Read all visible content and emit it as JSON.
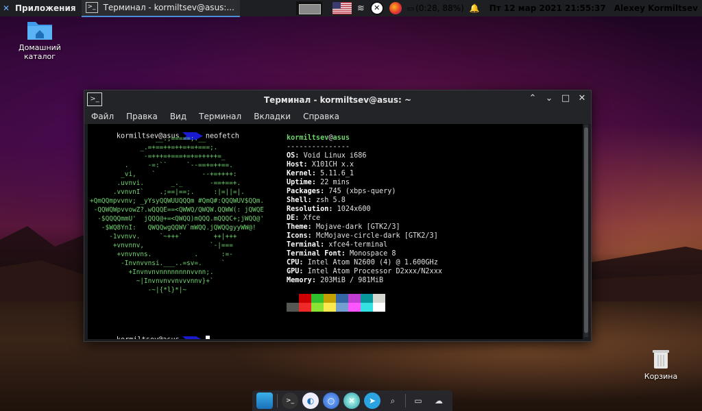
{
  "panel": {
    "apps_label": "Приложения",
    "task_label": "Терминал - kormiltsev@asus:...",
    "battery": "(0:28, 88%)",
    "datetime": "Пт 12 мар 2021 21:55:37",
    "user": "Alexey Kormiltsev"
  },
  "desktop": {
    "home_label_1": "Домашний",
    "home_label_2": "каталог",
    "trash_label": "Корзина"
  },
  "window": {
    "title": "Терминал - kormiltsev@asus: ~",
    "menu": [
      "Файл",
      "Правка",
      "Вид",
      "Терминал",
      "Вкладки",
      "Справка"
    ]
  },
  "terminal": {
    "prompt_user": "kormiltsev@asus",
    "command": "neofetch",
    "host_user": "kormiltsev",
    "host_at": "@",
    "host_name": "asus",
    "separator": "---------------",
    "info": [
      {
        "k": "OS",
        "v": "Void Linux i686"
      },
      {
        "k": "Host",
        "v": "X101CH x.x"
      },
      {
        "k": "Kernel",
        "v": "5.11.6_1"
      },
      {
        "k": "Uptime",
        "v": "22 mins"
      },
      {
        "k": "Packages",
        "v": "745 (xbps-query)"
      },
      {
        "k": "Shell",
        "v": "zsh 5.8"
      },
      {
        "k": "Resolution",
        "v": "1024x600"
      },
      {
        "k": "DE",
        "v": "Xfce"
      },
      {
        "k": "Theme",
        "v": "Mojave-dark [GTK2/3]"
      },
      {
        "k": "Icons",
        "v": "McMojave-circle-dark [GTK2/3]"
      },
      {
        "k": "Terminal",
        "v": "xfce4-terminal"
      },
      {
        "k": "Terminal Font",
        "v": "Monospace 8"
      },
      {
        "k": "CPU",
        "v": "Intel Atom N2600 (4) @ 1.600GHz"
      },
      {
        "k": "GPU",
        "v": "Intel Atom Processor D2xxx/N2xxx"
      },
      {
        "k": "Memory",
        "v": "203MiB / 981MiB"
      }
    ],
    "ascii": [
      "                 __.;=====;.__",
      "             _.=+==++=++=+=+===;.",
      "              -=+++=+===+=+=+++++=_",
      "         .     -=:``     `--==+=++==.",
      "        _vi,    `            --+=++++:",
      "       .uvnvi.       _._       -==+==+.",
      "      .vvnvnI`    .;==|==;.     :|=||=|.",
      "+QmQQmpvvnv; _yYsyQQWUUQQQm #QmQ#:QQQWUV$QQm.",
      " -QQWQWpvvowZ?.wQQQE==<QWWQ/QWQW.QQWW(: jQWQE",
      "  -$QQQQmmU'  jQQQ@+=<QWQQ)mQQQ.mQQQC+;jWQQ@'",
      "   -$WQ8YnI:   QWQQwgQQWV`mWQQ.jQWQQgyyWW@!",
      "     -1vvnvv.     `~+++`        ++|+++",
      "      +vnvnnv,                 `-|===",
      "       +vnvnvns.           .      :=-",
      "        -Invnvvnsi.___..=sv=.     `",
      "          +Invnvnvnnnnnnnnvvnn;.",
      "            ~|Invnvnvvnvvvnnv}+`",
      "               -~|{*l}*|~"
    ]
  },
  "palette": {
    "row1": [
      "#000000",
      "#cc0000",
      "#2fbf2f",
      "#c4a000",
      "#3465a4",
      "#c23ed0",
      "#06989a",
      "#d3d7cf"
    ],
    "row2": [
      "#555753",
      "#ef2929",
      "#8ae234",
      "#fce94f",
      "#729fcf",
      "#ff55ff",
      "#34e2e2",
      "#ffffff"
    ]
  }
}
